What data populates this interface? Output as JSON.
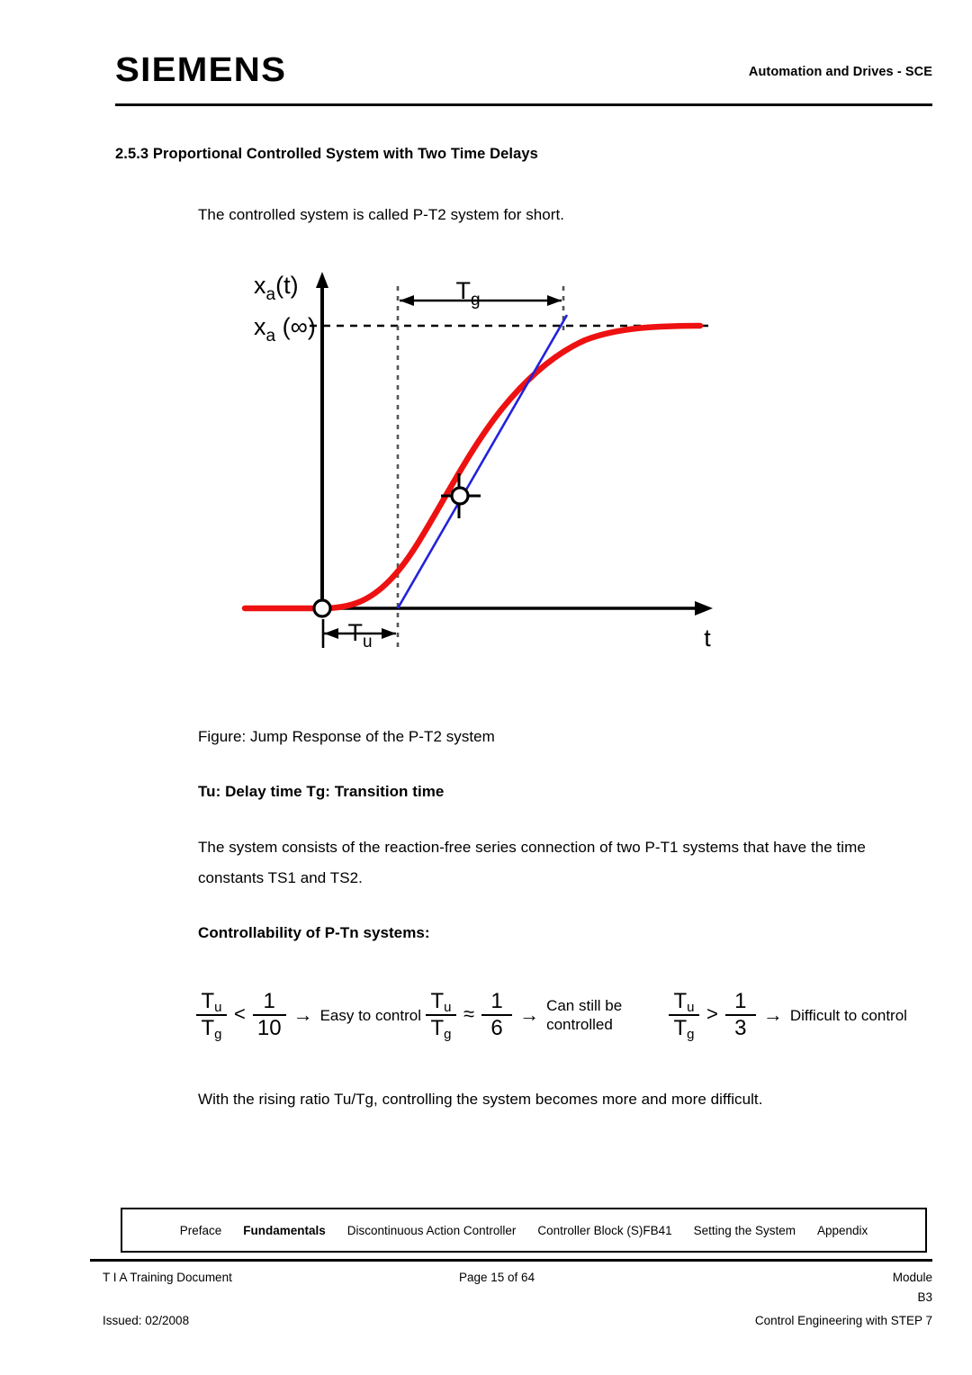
{
  "header": {
    "logo": "SIEMENS",
    "right_text": "Automation and Drives - SCE"
  },
  "section": {
    "heading": "2.5.3 Proportional Controlled System with Two Time Delays",
    "intro": "The controlled system is called P-T2 system for short.",
    "figure_caption": "Figure: Jump Response of the P-T2 system",
    "tu_tg_definition": "Tu: Delay time Tg:  Transition time",
    "series_paragraph": "The system consists of the reaction-free series connection of two P-T1 systems that have the time constants TS1 and TS2.",
    "controllability_heading": "Controllability of P-Tn systems:",
    "closing_paragraph": "With the rising ratio Tu/Tg, controlling the system becomes more and more difficult."
  },
  "chart_data": {
    "type": "line",
    "title": "Jump Response of the P-T2 system",
    "xlabel": "t",
    "ylabel": "xa(t)",
    "y_axis_label": "x",
    "y_axis_label_sub": "a",
    "y_axis_label_arg": "(t)",
    "asymptote_label": "x",
    "asymptote_label_sub": "a",
    "asymptote_label_arg": "(∞)",
    "x_axis_label": "t",
    "annotations": [
      {
        "name": "Tg",
        "base": "T",
        "sub": "g",
        "meaning": "Transition time"
      },
      {
        "name": "Tu",
        "base": "T",
        "sub": "u",
        "meaning": "Delay time"
      }
    ],
    "series": [
      {
        "name": "step-response",
        "color": "#ee1111",
        "description": "S-shaped P-T2 step response rising from 0 to xa(infinity)"
      },
      {
        "name": "inflection-tangent",
        "color": "#2222dd",
        "description": "Tangent at the inflection point, defines Tu and Tg"
      }
    ],
    "markers": [
      {
        "name": "origin-marker",
        "x": 0,
        "y": 0
      },
      {
        "name": "inflection-point-marker",
        "x": 0.46,
        "y": 0.42
      }
    ],
    "grid": false,
    "legend": "none"
  },
  "formulas": [
    {
      "id": "easy",
      "lhs_num": "T",
      "lhs_num_sub": "u",
      "lhs_den": "T",
      "lhs_den_sub": "g",
      "operator": "<",
      "rhs_num": "1",
      "rhs_den": "10",
      "arrow": "→",
      "result": "Easy to control"
    },
    {
      "id": "still",
      "lhs_num": "T",
      "lhs_num_sub": "u",
      "lhs_den": "T",
      "lhs_den_sub": "g",
      "operator": "≈",
      "rhs_num": "1",
      "rhs_den": "6",
      "arrow": "→",
      "result": "Can still be controlled"
    },
    {
      "id": "difficult",
      "lhs_num": "T",
      "lhs_num_sub": "u",
      "lhs_den": "T",
      "lhs_den_sub": "g",
      "operator": ">",
      "rhs_num": "1",
      "rhs_den": "3",
      "arrow": "→",
      "result": "Difficult to control"
    }
  ],
  "footer_nav": [
    {
      "label": "Preface",
      "active": false
    },
    {
      "label": "Fundamentals",
      "active": true
    },
    {
      "label": "Discontinuous Action Controller",
      "active": false
    },
    {
      "label": "Controller Block (S)FB41",
      "active": false
    },
    {
      "label": "Setting the System",
      "active": false
    },
    {
      "label": "Appendix",
      "active": false
    }
  ],
  "footer": {
    "doc_title": "T I A  Training Document",
    "page": "Page 15 of 64",
    "module_label": "Module",
    "module_value": "B3",
    "issued": "Issued:  02/2008",
    "course": "Control Engineering with STEP 7"
  }
}
